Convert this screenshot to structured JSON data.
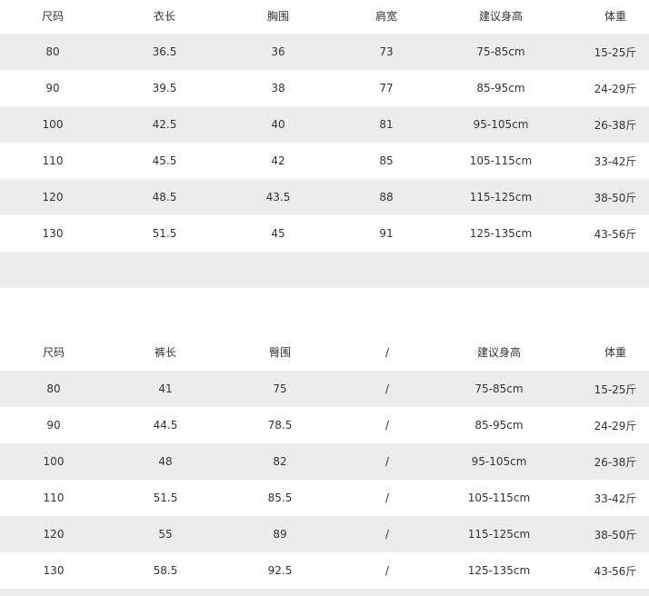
{
  "top_table": {
    "headers": [
      "尺码",
      "衣长",
      "胸围",
      "肩宽",
      "建议身高",
      "体重"
    ],
    "rows": [
      [
        "80",
        "36.5",
        "36",
        "73",
        "75-85cm",
        "15-25斤"
      ],
      [
        "90",
        "39.5",
        "38",
        "77",
        "85-95cm",
        "24-29斤"
      ],
      [
        "100",
        "42.5",
        "40",
        "81",
        "95-105cm",
        "26-38斤"
      ],
      [
        "110",
        "45.5",
        "42",
        "85",
        "105-115cm",
        "33-42斤"
      ],
      [
        "120",
        "48.5",
        "43.5",
        "88",
        "115-125cm",
        "38-50斤"
      ],
      [
        "130",
        "51.5",
        "45",
        "91",
        "125-135cm",
        "43-56斤"
      ]
    ]
  },
  "bottom_table": {
    "headers": [
      "尺码",
      "裤长",
      "臀围",
      "/",
      "建议身高",
      "体重"
    ],
    "rows": [
      [
        "80",
        "41",
        "75",
        "/",
        "75-85cm",
        "15-25斤"
      ],
      [
        "90",
        "44.5",
        "78.5",
        "/",
        "85-95cm",
        "24-29斤"
      ],
      [
        "100",
        "48",
        "82",
        "/",
        "95-105cm",
        "26-38斤"
      ],
      [
        "110",
        "51.5",
        "85.5",
        "/",
        "105-115cm",
        "33-42斤"
      ],
      [
        "120",
        "55",
        "89",
        "/",
        "115-125cm",
        "38-50斤"
      ],
      [
        "130",
        "58.5",
        "92.5",
        "/",
        "125-135cm",
        "43-56斤"
      ]
    ]
  },
  "colors": {
    "row_shade": "#ececec",
    "text": "#333333",
    "background": "#ffffff"
  }
}
